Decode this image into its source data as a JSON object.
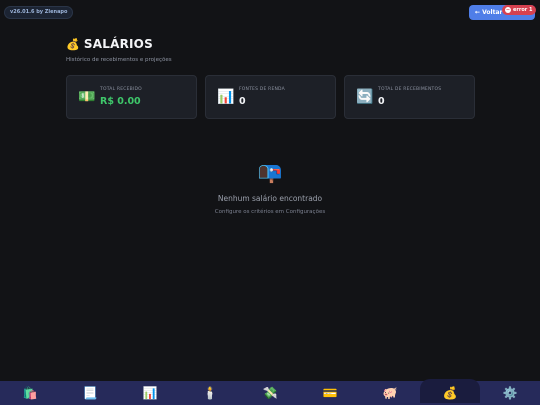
{
  "version_badge": "v26.01.6 by Zlenapo",
  "back_button": "← Voltar",
  "error_badge": {
    "count": "1",
    "label": "error"
  },
  "header": {
    "icon": "💰",
    "title": "SALÁRIOS",
    "subtitle": "Histórico de recebimentos e projeções"
  },
  "cards": [
    {
      "icon": "💵",
      "label": "Total Recebido",
      "value": "R$ 0.00"
    },
    {
      "icon": "📊",
      "label": "Fontes de Renda",
      "value": "0"
    },
    {
      "icon": "🔄",
      "label": "Total de Recebimentos",
      "value": "0"
    }
  ],
  "empty_state": {
    "icon": "📭",
    "title": "Nenhum salário encontrado",
    "subtitle": "Configure os critérios em Configurações"
  },
  "bottom_nav": [
    {
      "icon": "🛍️",
      "name": "shopping-bags-icon"
    },
    {
      "icon": "📃",
      "name": "document-icon"
    },
    {
      "icon": "📊",
      "name": "bar-chart-icon"
    },
    {
      "icon": "🕯️",
      "name": "candle-icon"
    },
    {
      "icon": "💸",
      "name": "money-with-wings-icon"
    },
    {
      "icon": "💳",
      "name": "credit-card-icon"
    },
    {
      "icon": "🐖",
      "name": "piggy-icon"
    },
    {
      "icon": "💰",
      "name": "money-bag-icon",
      "active": true
    },
    {
      "icon": "⚙️",
      "name": "gear-icon"
    }
  ],
  "colors": {
    "background": "#121316",
    "accent": "#4f7ee8",
    "positive": "#3ec76a",
    "error": "#d64150",
    "nav": "#262a5a"
  }
}
